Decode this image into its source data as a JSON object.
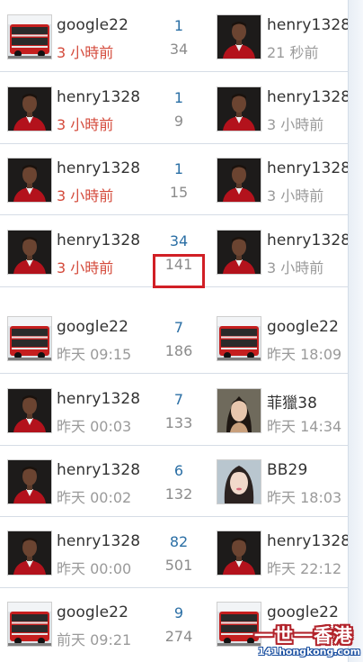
{
  "rows": [
    {
      "left_user": "google22",
      "left_time": "3 小時前",
      "left_avatar": "bus-avatar",
      "replies": "1",
      "views": "34",
      "right_user": "henry1328",
      "right_time": "21 秒前",
      "right_avatar": "man-avatar"
    },
    {
      "left_user": "henry1328",
      "left_time": "3 小時前",
      "left_avatar": "man-avatar",
      "replies": "1",
      "views": "9",
      "right_user": "henry1328",
      "right_time": "3 小時前",
      "right_avatar": "man-avatar"
    },
    {
      "left_user": "henry1328",
      "left_time": "3 小時前",
      "left_avatar": "man-avatar",
      "replies": "1",
      "views": "15",
      "right_user": "henry1328",
      "right_time": "3 小時前",
      "right_avatar": "man-avatar"
    },
    {
      "left_user": "henry1328",
      "left_time": "3 小時前",
      "left_avatar": "man-avatar",
      "replies": "34",
      "views": "141",
      "right_user": "henry1328",
      "right_time": "3 小時前",
      "right_avatar": "man-avatar"
    },
    {
      "left_user": "google22",
      "left_time": "昨天 09:15",
      "left_avatar": "bus-avatar",
      "replies": "7",
      "views": "186",
      "right_user": "google22",
      "right_time": "昨天 18:09",
      "right_avatar": "bus-avatar"
    },
    {
      "left_user": "henry1328",
      "left_time": "昨天 00:03",
      "left_avatar": "man-avatar",
      "replies": "7",
      "views": "133",
      "right_user": "菲獵38",
      "right_time": "昨天 14:34",
      "right_avatar": "woman-avatar"
    },
    {
      "left_user": "henry1328",
      "left_time": "昨天 00:02",
      "left_avatar": "man-avatar",
      "replies": "6",
      "views": "132",
      "right_user": "BB29",
      "right_time": "昨天 18:03",
      "right_avatar": "woman2-avatar"
    },
    {
      "left_user": "henry1328",
      "left_time": "昨天 00:00",
      "left_avatar": "man-avatar",
      "replies": "82",
      "views": "501",
      "right_user": "henry1328",
      "right_time": "昨天 22:12",
      "right_avatar": "man-avatar"
    },
    {
      "left_user": "google22",
      "left_time": "前天 09:21",
      "left_avatar": "bus-avatar",
      "replies": "9",
      "views": "274",
      "right_user": "google22",
      "right_time": "",
      "right_avatar": "bus-avatar"
    }
  ],
  "watermark": {
    "title": "一世一香港",
    "url": "141hongkong.com"
  },
  "colors": {
    "recent_time": "#d44b3c",
    "old_time": "#9a9a9a",
    "replies": "#2b6fa5",
    "views": "#8c8c8c",
    "highlight": "#d11f25",
    "divider": "#d6dde6"
  }
}
